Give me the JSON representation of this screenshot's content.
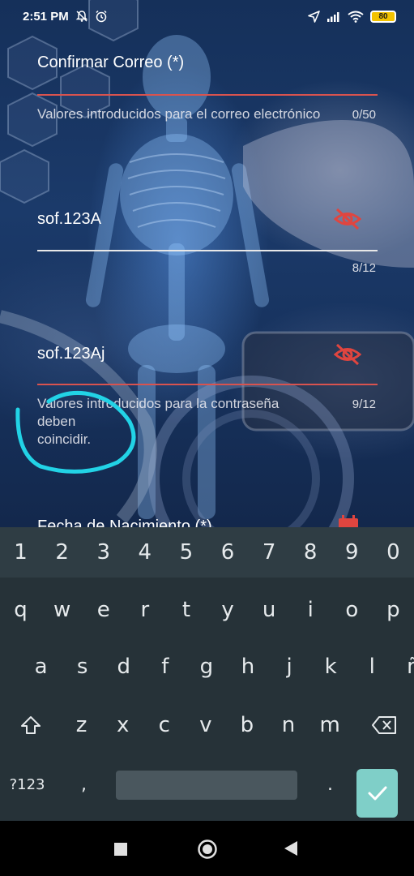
{
  "status_bar": {
    "time": "2:51 PM",
    "icons_left": [
      "bell-off-icon",
      "alarm-icon"
    ],
    "icons_right": [
      "location-arrow-icon",
      "signal-icon",
      "wifi-icon"
    ],
    "battery_level": "80"
  },
  "form": {
    "confirm_email": {
      "label": "Confirmar Correo (*)",
      "helper": "Valores introducidos para el correo electrónico",
      "counter": "0/50"
    },
    "password": {
      "value": "sof.123A",
      "counter": "8/12",
      "icon": "eye-off-icon"
    },
    "confirm_password": {
      "value": "sof.123Aj",
      "helper_line1": "Valores introducidos para la contraseña",
      "helper_line2": "deben",
      "helper_line3": "coincidir.",
      "counter": "9/12",
      "icon": "eye-off-icon"
    },
    "birth_date": {
      "label": "Fecha de Nacimiento (*)",
      "icon": "calendar-icon"
    },
    "colors": {
      "error_red": "#d9534f",
      "annotation_cyan": "#22d3e6"
    }
  },
  "keyboard": {
    "numbers": [
      "1",
      "2",
      "3",
      "4",
      "5",
      "6",
      "7",
      "8",
      "9",
      "0"
    ],
    "row1": [
      "q",
      "w",
      "e",
      "r",
      "t",
      "y",
      "u",
      "i",
      "o",
      "p"
    ],
    "row2": [
      "a",
      "s",
      "d",
      "f",
      "g",
      "h",
      "j",
      "k",
      "l",
      "ñ"
    ],
    "row3": [
      "z",
      "x",
      "c",
      "v",
      "b",
      "n",
      "m"
    ],
    "symbols_key": "?123",
    "comma_key": ",",
    "period_key": ".",
    "shift_icon": "shift-icon",
    "backspace_icon": "backspace-icon",
    "enter_icon": "check-icon",
    "colors": {
      "background": "#263238",
      "enter": "#7fcfc8"
    }
  },
  "nav_bar": {
    "buttons": [
      "recents-square-icon",
      "home-circle-icon",
      "back-triangle-icon"
    ]
  }
}
